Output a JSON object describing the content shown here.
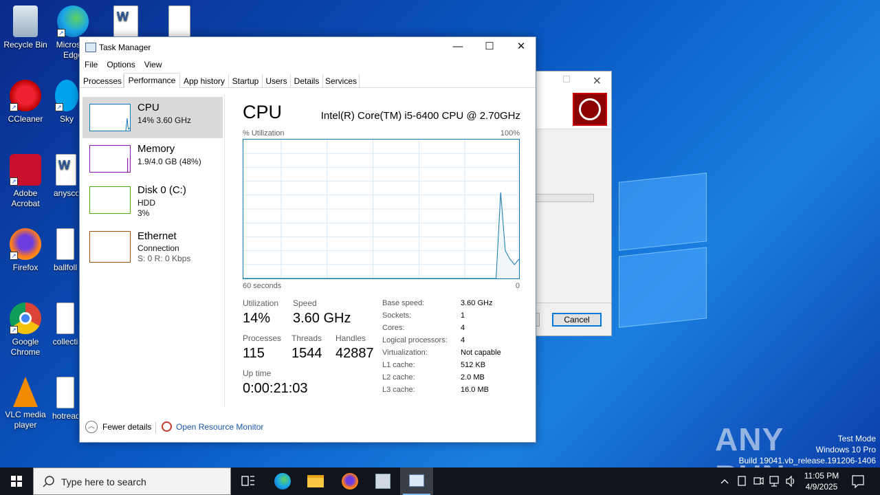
{
  "desktop": {
    "icons": [
      {
        "label": "Recycle Bin"
      },
      {
        "label": "Micro­soft Edge"
      },
      {
        "label": "CCleaner"
      },
      {
        "label": "Sky"
      },
      {
        "label": "Adobe Acrobat"
      },
      {
        "label": "anysco"
      },
      {
        "label": "Firefox"
      },
      {
        "label": "ballfoll"
      },
      {
        "label": "Google Chrome"
      },
      {
        "label": "collecti"
      },
      {
        "label": "VLC media player"
      },
      {
        "label": "hotread"
      }
    ],
    "watermark": "ANY RUN",
    "test_mode": [
      "Test Mode",
      "Windows 10 Pro",
      "Build 19041.vb_release.191206-1406"
    ]
  },
  "bg_dialog": {
    "cancel_label": "Cancel"
  },
  "task_manager": {
    "title": "Task Manager",
    "window_buttons": {
      "minimize": "—",
      "maximize": "☐",
      "close": "✕"
    },
    "menu": [
      "File",
      "Options",
      "View"
    ],
    "tabs": [
      "Processes",
      "Performance",
      "App history",
      "Startup",
      "Users",
      "Details",
      "Services"
    ],
    "active_tab": "Performance",
    "sidebar": [
      {
        "name": "CPU",
        "sub1": "14% 3.60 GHz",
        "color": "#1175b3"
      },
      {
        "name": "Memory",
        "sub1": "1.9/4.0 GB (48%)",
        "color": "#8b12ae"
      },
      {
        "name": "Disk 0 (C:)",
        "sub1": "HDD",
        "sub2": "3%",
        "color": "#4da60c"
      },
      {
        "name": "Ethernet",
        "sub1": "Connection",
        "sub2": "S: 0 R: 0 Kbps",
        "color": "#a74f01"
      }
    ],
    "main": {
      "heading": "CPU",
      "model": "Intel(R) Core(TM) i5-6400 CPU @ 2.70GHz",
      "util_label": "% Utilization",
      "max_label": "100%",
      "time_label": "60 seconds",
      "zero_label": "0",
      "stats": {
        "utilization_label": "Utilization",
        "utilization": "14%",
        "speed_label": "Speed",
        "speed": "3.60 GHz",
        "processes_label": "Processes",
        "processes": "115",
        "threads_label": "Threads",
        "threads": "1544",
        "handles_label": "Handles",
        "handles": "42887",
        "uptime_label": "Up time",
        "uptime": "0:00:21:03"
      },
      "specs": [
        {
          "k": "Base speed:",
          "v": "3.60 GHz"
        },
        {
          "k": "Sockets:",
          "v": "1"
        },
        {
          "k": "Cores:",
          "v": "4"
        },
        {
          "k": "Logical processors:",
          "v": "4"
        },
        {
          "k": "Virtualization:",
          "v": "Not capable"
        },
        {
          "k": "L1 cache:",
          "v": "512 KB"
        },
        {
          "k": "L2 cache:",
          "v": "2.0 MB"
        },
        {
          "k": "L3 cache:",
          "v": "16.0 MB"
        }
      ],
      "graph_series": [
        0,
        0,
        0,
        0,
        0,
        0,
        0,
        0,
        0,
        0,
        0,
        0,
        0,
        0,
        0,
        0,
        0,
        0,
        0,
        0,
        0,
        0,
        0,
        0,
        0,
        0,
        0,
        0,
        0,
        0,
        0,
        0,
        0,
        0,
        0,
        0,
        0,
        0,
        0,
        0,
        0,
        0,
        0,
        0,
        0,
        0,
        0,
        0,
        0,
        0,
        0,
        0,
        0,
        0,
        0,
        0,
        62,
        20,
        14,
        10,
        14
      ]
    },
    "footer": {
      "fewer": "Fewer details",
      "resource_monitor": "Open Resource Monitor"
    }
  },
  "taskbar": {
    "search_placeholder": "Type here to search",
    "time": "11:05 PM",
    "date": "4/9/2025"
  }
}
